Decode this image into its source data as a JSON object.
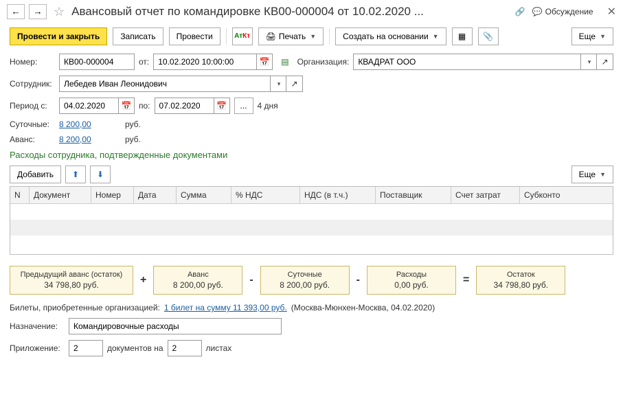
{
  "header": {
    "title": "Авансовый отчет по командировке КВ00-000004 от 10.02.2020 ...",
    "discussion": "Обсуждение"
  },
  "toolbar": {
    "post_close": "Провести и закрыть",
    "save": "Записать",
    "post": "Провести",
    "print": "Печать",
    "create_based": "Создать на основании",
    "more": "Еще"
  },
  "fields": {
    "number_label": "Номер:",
    "number": "КВ00-000004",
    "from_label": "от:",
    "date": "10.02.2020 10:00:00",
    "org_label": "Организация:",
    "org": "КВАДРАТ ООО",
    "employee_label": "Сотрудник:",
    "employee": "Лебедев Иван Леонидович",
    "period_from_label": "Период с:",
    "period_from": "04.02.2020",
    "period_to_label": "по:",
    "period_to": "07.02.2020",
    "days": "4 дня",
    "per_diem_label": "Суточные:",
    "per_diem": "8 200,00",
    "advance_label": "Аванс:",
    "advance": "8 200,00",
    "rub": "руб."
  },
  "expenses": {
    "title": "Расходы сотрудника, подтвержденные документами",
    "add": "Добавить",
    "more": "Еще",
    "cols": {
      "n": "N",
      "doc": "Документ",
      "num": "Номер",
      "date": "Дата",
      "sum": "Сумма",
      "vat_pct": "% НДС",
      "vat": "НДС (в т.ч.)",
      "supplier": "Поставщик",
      "account": "Счет затрат",
      "subconto": "Субконто"
    }
  },
  "summary": {
    "prev_label": "Предыдущий аванс (остаток)",
    "prev_val": "34 798,80 руб.",
    "adv_label": "Аванс",
    "adv_val": "8 200,00 руб.",
    "pd_label": "Суточные",
    "pd_val": "8 200,00 руб.",
    "exp_label": "Расходы",
    "exp_val": "0,00 руб.",
    "rest_label": "Остаток",
    "rest_val": "34 798,80 руб."
  },
  "tickets": {
    "label": "Билеты, приобретенные организацией:",
    "link": "1 билет на сумму 11 393,00 руб.",
    "route": "(Москва-Мюнхен-Москва, 04.02.2020)"
  },
  "purpose": {
    "label": "Назначение:",
    "value": "Командировочные расходы"
  },
  "attach": {
    "label": "Приложение:",
    "count": "2",
    "docs_on": "документов на",
    "sheets": "2",
    "sheets_label": "листах"
  }
}
